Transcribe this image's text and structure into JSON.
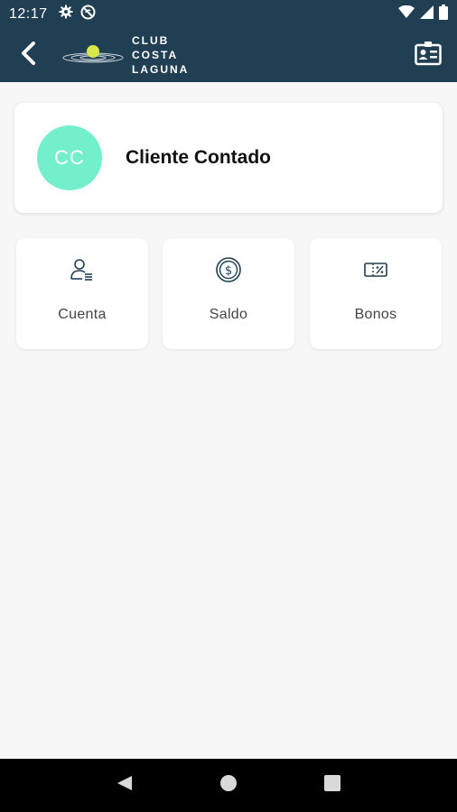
{
  "status_bar": {
    "time": "12:17",
    "left_icons": [
      "gear-icon",
      "no-sync-icon"
    ],
    "right_icons": [
      "wifi-icon",
      "signal-icon",
      "battery-icon"
    ]
  },
  "app_bar": {
    "logo_lines": [
      "CLUB",
      "COSTA",
      "LAGUNA"
    ],
    "back_icon": "chevron-left-icon",
    "action_icon": "id-card-icon"
  },
  "profile": {
    "initials": "CC",
    "name": "Cliente Contado",
    "avatar_color": "#73f0cb"
  },
  "tiles": [
    {
      "label": "Cuenta",
      "icon": "user-list-icon"
    },
    {
      "label": "Saldo",
      "icon": "coin-icon"
    },
    {
      "label": "Bonos",
      "icon": "voucher-icon"
    }
  ],
  "nav_bar": {
    "buttons": [
      "back-triangle-icon",
      "home-circle-icon",
      "recents-square-icon"
    ]
  },
  "colors": {
    "primary": "#213f53",
    "accent": "#73f0cb",
    "background": "#f7f7f7"
  }
}
